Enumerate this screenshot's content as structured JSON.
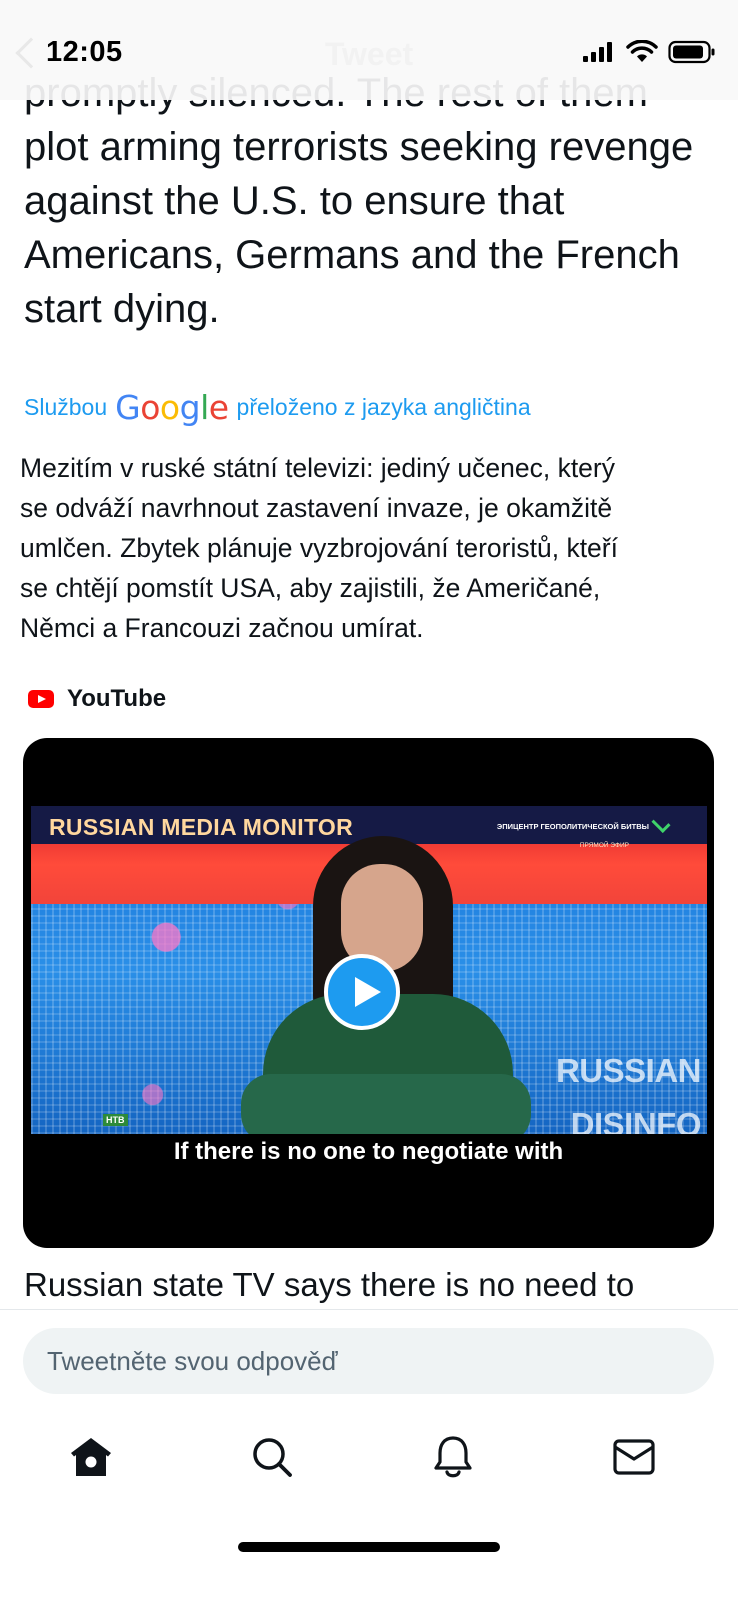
{
  "status_bar": {
    "time": "12:05",
    "header_title": "Tweet",
    "icons": [
      "back-chevron-icon",
      "cellular-signal-icon",
      "wifi-icon",
      "battery-icon"
    ]
  },
  "tweet": {
    "clipped_line": "promptly silenced. The rest of them",
    "lines": [
      "plot arming terrorists seeking revenge",
      "against the U.S. to ensure that",
      "Americans, Germans and the French",
      "start dying."
    ]
  },
  "translation_notice": {
    "prefix": "Službou",
    "brand": [
      "G",
      "o",
      "o",
      "g",
      "l",
      "e"
    ],
    "brand_colors": [
      "#4285F4",
      "#EA4335",
      "#FBBC05",
      "#4285F4",
      "#34A853",
      "#EA4335"
    ],
    "suffix": "přeloženo z jazyka angličtina",
    "link_color": "#1d9bf0"
  },
  "translation": {
    "lines": [
      "Mezitím v ruské státní televizi: jediný učenec, který",
      "se odváží navrhnout zastavení invaze, je okamžitě",
      "umlčen. Zbytek plánuje vyzbrojování teroristů, kteří",
      "se chtějí pomstít USA, aby zajistili, že Američané,",
      "Němci a Francouzi začnou umírat."
    ]
  },
  "card": {
    "source": "YouTube",
    "video": {
      "banner": "RUSSIAN MEDIA MONITOR",
      "banner_small": "ЭПИЦЕНТР ГЕОПОЛИТИЧЕСКОЙ БИТВЫ",
      "banner_small2": "ПРЯМОЙ ЭФИР",
      "watermark": [
        "RUSSIAN",
        "DISINFO"
      ],
      "channel_logo": "НТВ",
      "subtitle": "If there is no one to negotiate with"
    },
    "title": "Russian state TV says there is no need to"
  },
  "reply": {
    "placeholder": "Tweetněte svou odpověď"
  },
  "tab_bar": {
    "tabs": [
      "home-icon",
      "search-icon",
      "notifications-icon",
      "messages-icon"
    ]
  },
  "colors": {
    "text": "#0f1419",
    "accent": "#1d9bf0",
    "input_bg": "#eff3f4",
    "youtube_red": "#ff0000"
  }
}
